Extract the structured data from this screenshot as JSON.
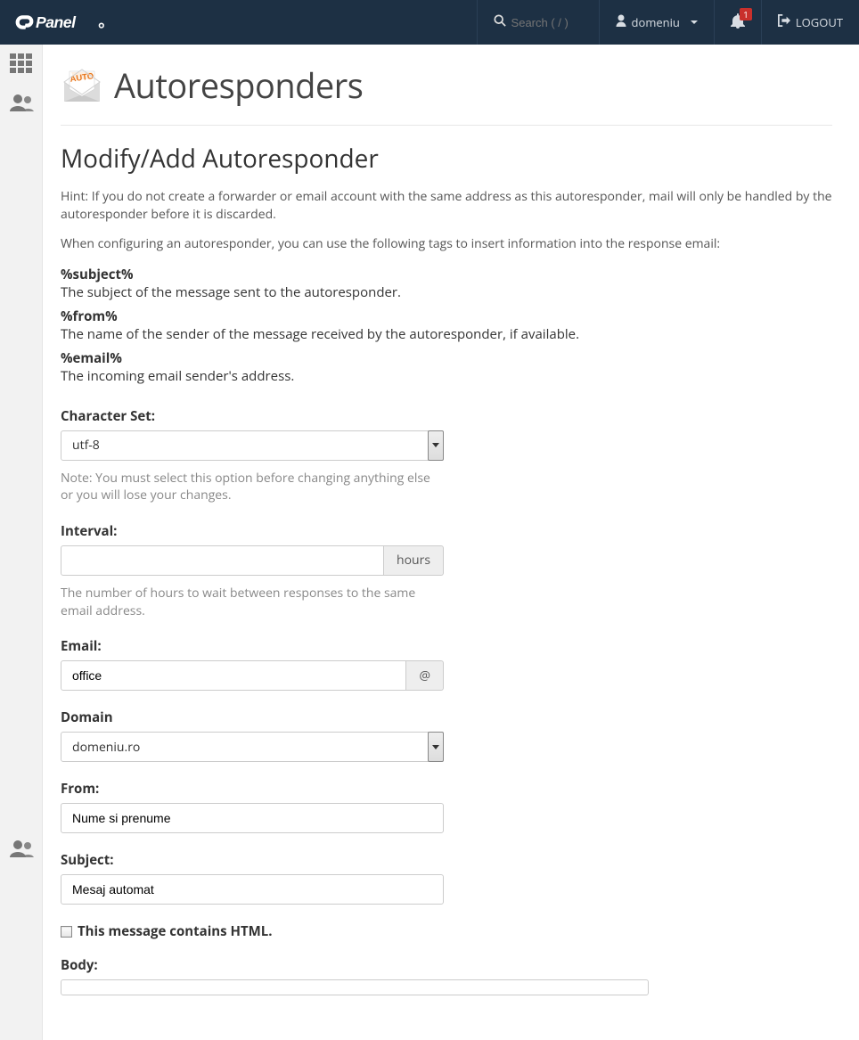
{
  "header": {
    "search_placeholder": "Search ( / )",
    "user_label": "domeniu",
    "notif_count": "1",
    "logout_label": "LOGOUT"
  },
  "page": {
    "title": "Autoresponders",
    "subtitle": "Modify/Add Autoresponder",
    "hint": "Hint: If you do not create a forwarder or email account with the same address as this autoresponder, mail will only be handled by the autoresponder before it is discarded.",
    "tags_intro": "When configuring an autoresponder, you can use the following tags to insert information into the response email:",
    "tags": {
      "subject_key": "%subject%",
      "subject_desc": "The subject of the message sent to the autoresponder.",
      "from_key": "%from%",
      "from_desc": "The name of the sender of the message received by the autoresponder, if available.",
      "email_key": "%email%",
      "email_desc": "The incoming email sender's address."
    }
  },
  "form": {
    "charset_label": "Character Set:",
    "charset_value": "utf-8",
    "charset_note": "Note: You must select this option before changing anything else or you will lose your changes.",
    "interval_label": "Interval:",
    "interval_value": "",
    "interval_addon": "hours",
    "interval_note": "The number of hours to wait between responses to the same email address.",
    "email_label": "Email:",
    "email_value": "office",
    "email_addon": "@",
    "domain_label": "Domain",
    "domain_value": "domeniu.ro",
    "from_label": "From:",
    "from_value": "Nume si prenume",
    "subject_label": "Subject:",
    "subject_value": "Mesaj automat",
    "html_check_label": "This message contains HTML.",
    "body_label": "Body:"
  }
}
